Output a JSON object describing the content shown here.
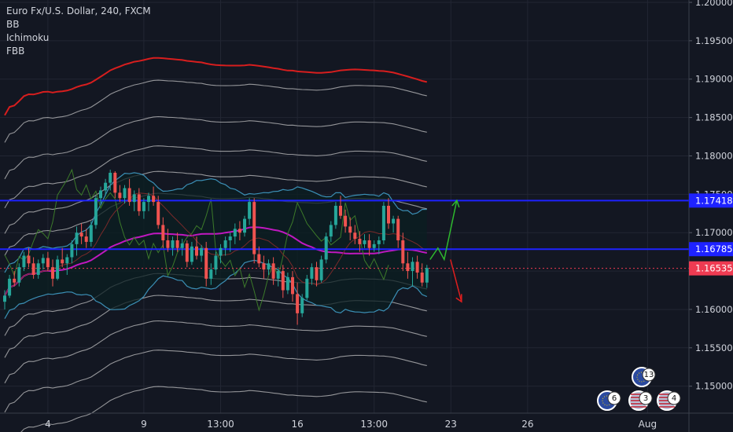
{
  "chart_title": "Euro Fx/U.S. Dollar, 240, FXCM",
  "indicators": [
    "BB",
    "Ichimoku",
    "FBB"
  ],
  "colors": {
    "background": "#131722",
    "grid": "#222633",
    "axis_text": "#d1d4dc",
    "candle_up": "#26a69a",
    "candle_down": "#ef5350",
    "level_line": "#1e22ff",
    "price_label_bg": "#1e22ff",
    "current_label_bg": "#ef3b52",
    "ma_line": "#c018c0",
    "top_band": "#d71e1e",
    "fbb_band": "#cccccc",
    "bb_band": "#3b8fb5",
    "arrow_up": "#2eb82e",
    "arrow_down": "#e01e1e"
  },
  "events": [
    {
      "label": "13",
      "flag": "eu"
    },
    {
      "label": "6",
      "flag": "eu"
    },
    {
      "label": "3",
      "flag": "us"
    },
    {
      "label": "4",
      "flag": "us"
    }
  ],
  "chart_data": {
    "type": "candlestick",
    "symbol": "EURUSD",
    "timeframe": "240",
    "ylim": [
      1.147,
      1.2
    ],
    "y_ticks": [
      "1.20000",
      "1.19500",
      "1.19000",
      "1.18500",
      "1.18000",
      "1.17500",
      "1.17000",
      "1.16500",
      "1.16000",
      "1.15500",
      "1.15000"
    ],
    "x_ticks": [
      "4",
      "9",
      "13:00",
      "16",
      "13:00",
      "23",
      "26",
      "Aug"
    ],
    "x_tick_candle_index": [
      9,
      29,
      45,
      61,
      77,
      93,
      109,
      134
    ],
    "price_labels": [
      {
        "value": "1.17418",
        "type": "level"
      },
      {
        "value": "1.16785",
        "type": "level"
      },
      {
        "value": "1.16535",
        "type": "current"
      }
    ],
    "horizontal_levels": [
      1.17418,
      1.16785
    ],
    "current_price": 1.16535,
    "candle_width_approx": 4,
    "ohlc": [
      [
        1.161,
        1.1625,
        1.16,
        1.1618
      ],
      [
        1.1618,
        1.1645,
        1.1615,
        1.164
      ],
      [
        1.164,
        1.165,
        1.163,
        1.1635
      ],
      [
        1.1635,
        1.166,
        1.163,
        1.1655
      ],
      [
        1.1655,
        1.1675,
        1.165,
        1.167
      ],
      [
        1.167,
        1.168,
        1.1655,
        1.166
      ],
      [
        1.166,
        1.1668,
        1.164,
        1.1645
      ],
      [
        1.1645,
        1.1665,
        1.164,
        1.166
      ],
      [
        1.166,
        1.1672,
        1.1652,
        1.1667
      ],
      [
        1.1667,
        1.1675,
        1.165,
        1.1655
      ],
      [
        1.1655,
        1.1665,
        1.163,
        1.164
      ],
      [
        1.164,
        1.167,
        1.1638,
        1.1665
      ],
      [
        1.1665,
        1.168,
        1.1655,
        1.166
      ],
      [
        1.166,
        1.1672,
        1.1645,
        1.1668
      ],
      [
        1.1668,
        1.169,
        1.166,
        1.1685
      ],
      [
        1.1685,
        1.1708,
        1.167,
        1.17
      ],
      [
        1.17,
        1.1712,
        1.1685,
        1.1695
      ],
      [
        1.1695,
        1.1705,
        1.168,
        1.1688
      ],
      [
        1.1688,
        1.1715,
        1.1682,
        1.171
      ],
      [
        1.171,
        1.1748,
        1.1705,
        1.1745
      ],
      [
        1.1745,
        1.176,
        1.1738,
        1.1755
      ],
      [
        1.1755,
        1.177,
        1.1748,
        1.1765
      ],
      [
        1.1765,
        1.1782,
        1.1755,
        1.1778
      ],
      [
        1.1778,
        1.178,
        1.1745,
        1.1752
      ],
      [
        1.1752,
        1.1762,
        1.174,
        1.1745
      ],
      [
        1.1745,
        1.1762,
        1.1738,
        1.1758
      ],
      [
        1.1758,
        1.177,
        1.1735,
        1.174
      ],
      [
        1.174,
        1.1755,
        1.1728,
        1.175
      ],
      [
        1.175,
        1.1758,
        1.1722,
        1.1728
      ],
      [
        1.1728,
        1.1745,
        1.1718,
        1.174
      ],
      [
        1.174,
        1.1752,
        1.1728,
        1.1748
      ],
      [
        1.1748,
        1.176,
        1.1735,
        1.174
      ],
      [
        1.174,
        1.1748,
        1.1705,
        1.171
      ],
      [
        1.171,
        1.172,
        1.168,
        1.169
      ],
      [
        1.169,
        1.1705,
        1.1675,
        1.168
      ],
      [
        1.168,
        1.1695,
        1.167,
        1.169
      ],
      [
        1.169,
        1.17,
        1.1675,
        1.168
      ],
      [
        1.168,
        1.1692,
        1.167,
        1.1686
      ],
      [
        1.1686,
        1.169,
        1.1655,
        1.1662
      ],
      [
        1.1662,
        1.1688,
        1.1658,
        1.1682
      ],
      [
        1.1682,
        1.1695,
        1.1665,
        1.167
      ],
      [
        1.167,
        1.1684,
        1.1662,
        1.168
      ],
      [
        1.168,
        1.1688,
        1.163,
        1.164
      ],
      [
        1.164,
        1.166,
        1.1632,
        1.1652
      ],
      [
        1.1652,
        1.1675,
        1.1645,
        1.167
      ],
      [
        1.167,
        1.1685,
        1.166,
        1.168
      ],
      [
        1.168,
        1.1695,
        1.167,
        1.169
      ],
      [
        1.169,
        1.17,
        1.1675,
        1.1695
      ],
      [
        1.1695,
        1.1712,
        1.1685,
        1.1705
      ],
      [
        1.1705,
        1.1715,
        1.169,
        1.17
      ],
      [
        1.17,
        1.1722,
        1.1695,
        1.1718
      ],
      [
        1.1718,
        1.1745,
        1.171,
        1.174
      ],
      [
        1.174,
        1.1745,
        1.166,
        1.1672
      ],
      [
        1.1672,
        1.1682,
        1.1655,
        1.166
      ],
      [
        1.166,
        1.167,
        1.164,
        1.1652
      ],
      [
        1.1652,
        1.1665,
        1.1645,
        1.166
      ],
      [
        1.166,
        1.1668,
        1.1632,
        1.164
      ],
      [
        1.164,
        1.1655,
        1.163,
        1.165
      ],
      [
        1.165,
        1.1658,
        1.1615,
        1.1625
      ],
      [
        1.1625,
        1.1648,
        1.162,
        1.1642
      ],
      [
        1.1642,
        1.165,
        1.161,
        1.162
      ],
      [
        1.162,
        1.1635,
        1.158,
        1.1595
      ],
      [
        1.1595,
        1.162,
        1.159,
        1.1615
      ],
      [
        1.1615,
        1.1645,
        1.1612,
        1.164
      ],
      [
        1.164,
        1.166,
        1.1632,
        1.1655
      ],
      [
        1.1655,
        1.1662,
        1.163,
        1.1638
      ],
      [
        1.1638,
        1.167,
        1.1635,
        1.1665
      ],
      [
        1.1665,
        1.17,
        1.166,
        1.1695
      ],
      [
        1.1695,
        1.1715,
        1.1688,
        1.171
      ],
      [
        1.171,
        1.174,
        1.1705,
        1.1735
      ],
      [
        1.1735,
        1.1748,
        1.1718,
        1.1722
      ],
      [
        1.1722,
        1.173,
        1.17,
        1.1708
      ],
      [
        1.1708,
        1.172,
        1.169,
        1.17
      ],
      [
        1.17,
        1.171,
        1.1685,
        1.1692
      ],
      [
        1.1692,
        1.1702,
        1.1675,
        1.1685
      ],
      [
        1.1685,
        1.1698,
        1.168,
        1.169
      ],
      [
        1.169,
        1.1698,
        1.167,
        1.168
      ],
      [
        1.168,
        1.169,
        1.1675,
        1.1685
      ],
      [
        1.1685,
        1.1695,
        1.1672,
        1.169
      ],
      [
        1.169,
        1.174,
        1.1685,
        1.1735
      ],
      [
        1.1735,
        1.1745,
        1.1705,
        1.1712
      ],
      [
        1.1712,
        1.1722,
        1.17,
        1.1718
      ],
      [
        1.1718,
        1.1722,
        1.168,
        1.169
      ],
      [
        1.169,
        1.17,
        1.165,
        1.166
      ],
      [
        1.166,
        1.1675,
        1.164,
        1.165
      ],
      [
        1.165,
        1.1668,
        1.163,
        1.1662
      ],
      [
        1.1662,
        1.167,
        1.164,
        1.1648
      ],
      [
        1.1648,
        1.166,
        1.163,
        1.1635
      ],
      [
        1.1635,
        1.1658,
        1.1628,
        1.1654
      ]
    ]
  }
}
